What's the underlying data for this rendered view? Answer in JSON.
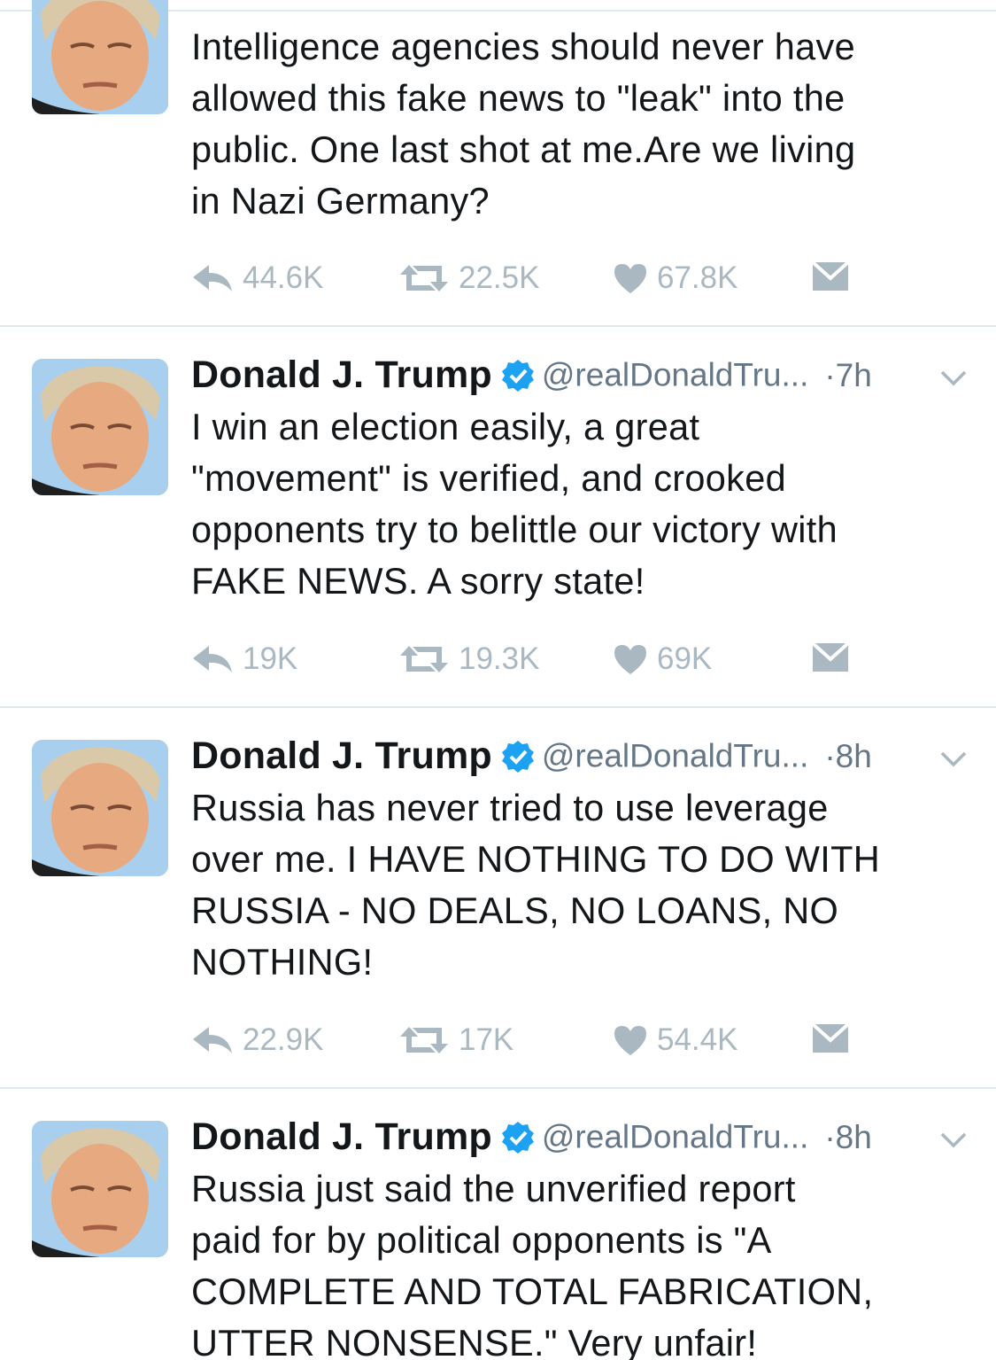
{
  "tweets": [
    {
      "name": "",
      "handle": "",
      "time": "",
      "lines": [
        "Intelligence agencies should never have",
        "allowed this fake news to \"leak\" into the",
        "public. One last shot at me.Are we living",
        "in Nazi Germany?"
      ],
      "replies": "44.6K",
      "retweets": "22.5K",
      "likes": "67.8K"
    },
    {
      "name": "Donald J. Trump",
      "handle": "@realDonaldTru...",
      "time": "·7h",
      "lines": [
        "I win an election easily, a great",
        "\"movement\" is verified, and crooked",
        "opponents try to belittle our victory with",
        "FAKE NEWS. A sorry state!"
      ],
      "replies": "19K",
      "retweets": "19.3K",
      "likes": "69K"
    },
    {
      "name": "Donald J. Trump",
      "handle": "@realDonaldTru...",
      "time": "·8h",
      "lines": [
        "Russia has never tried to use leverage",
        "over me. I HAVE NOTHING TO DO WITH",
        "RUSSIA - NO DEALS, NO LOANS, NO",
        "NOTHING!"
      ],
      "replies": "22.9K",
      "retweets": "17K",
      "likes": "54.4K"
    },
    {
      "name": "Donald J. Trump",
      "handle": "@realDonaldTru...",
      "time": "·8h",
      "lines": [
        "Russia just said the unverified report",
        "paid for by political opponents is \"A",
        "COMPLETE AND TOTAL FABRICATION,",
        "UTTER NONSENSE.\" Very unfair!"
      ]
    }
  ],
  "colors": {
    "muted": "#aab8c2",
    "meta": "#657786",
    "verified": "#1da1f2",
    "divider": "#e1e8ed"
  },
  "icons": [
    "reply-icon",
    "retweet-icon",
    "like-icon",
    "direct-message-icon",
    "verified-badge-icon",
    "chevron-down-icon"
  ]
}
